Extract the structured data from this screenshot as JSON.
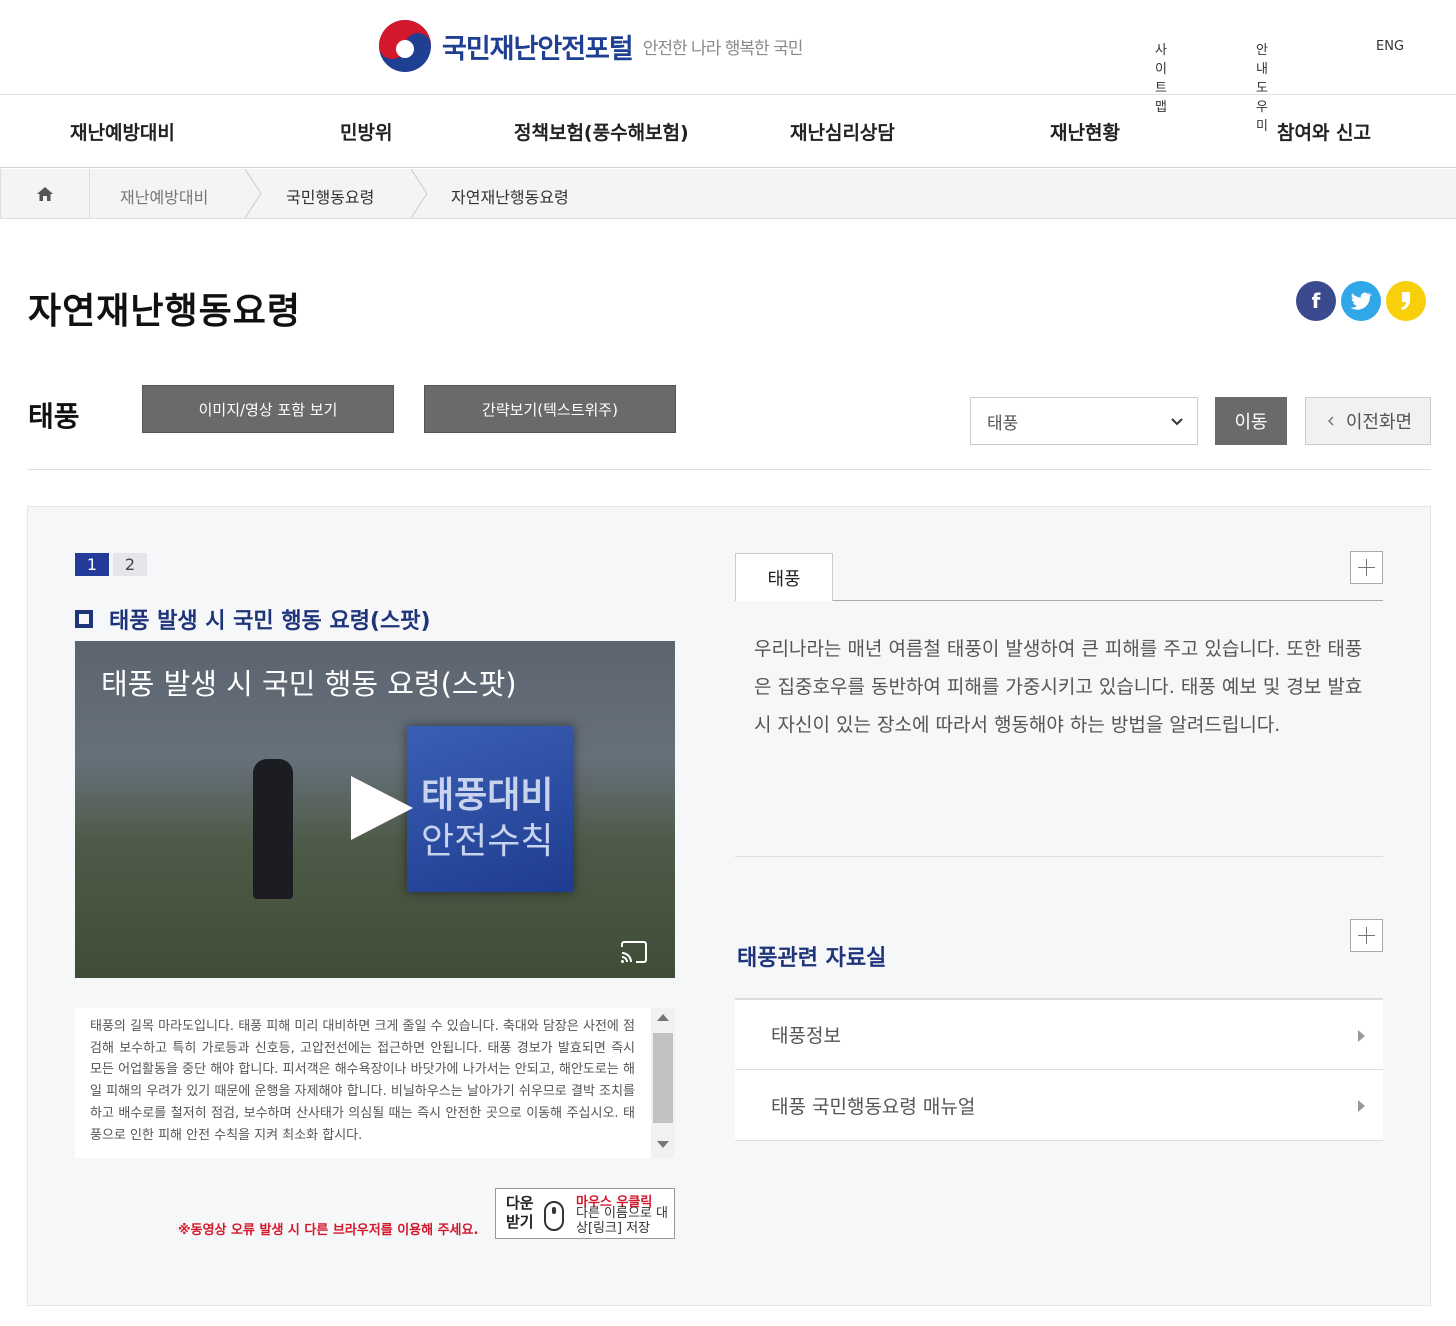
{
  "header": {
    "site_title": "국민재난안전포털",
    "slogan": "안전한 나라 행복한 국민",
    "util_links": [
      "사이트맵",
      "안내도우미",
      "ENG"
    ]
  },
  "gnb": [
    "재난예방대비",
    "민방위",
    "정책보험(풍수해보험)",
    "재난심리상담",
    "재난현황",
    "참여와 신고"
  ],
  "breadcrumb": [
    "재난예방대비",
    "국민행동요령",
    "자연재난행동요령"
  ],
  "page": {
    "title": "자연재난행동요령",
    "share": [
      "f",
      "t",
      "k"
    ]
  },
  "controls": {
    "section": "태풍",
    "view_full": "이미지/영상 포함 보기",
    "view_simple": "간략보기(텍스트위주)",
    "select_value": "태풍",
    "go": "이동",
    "back": "이전화면"
  },
  "video": {
    "pages": [
      "1",
      "2"
    ],
    "heading": "태풍 발생 시 국민 행동 요령(스팟)",
    "caption": "태풍 발생 시 국민 행동 요령(스팟)",
    "thumb_line1": "태풍대비",
    "thumb_line2": "안전수칙",
    "transcript": "태풍의 길목 마라도입니다. 태풍 피해 미리 대비하면 크게 줄일 수 있습니다. 축대와 담장은 사전에 점검해 보수하고 특히 가로등과 신호등, 고압전선에는 접근하면 안됩니다. 태풍 경보가 발효되면 즉시 모든 어업활동을 중단 해야 합니다. 피서객은 해수욕장이나 바닷가에 나가서는 안되고, 해안도로는 해일 피해의 우려가 있기 때문에 운행을 자제해야 합니다. 비닐하우스는 날아가기 쉬우므로 결박 조치를 하고 배수로를 철저히 점검, 보수하며 산사태가 의심될 때는 즉시 안전한 곳으로 이동해 주십시오. 태풍으로 인한 피해 안전 수칙을 지켜 최소화 합시다.",
    "notice": "※동영상 오류 발생 시 다른 브라우저를 이용해 주세요.",
    "download_label": "다운받기",
    "download_red": "마우스 우클릭",
    "download_text": "다른 이름으로 대상[링크] 저장"
  },
  "info": {
    "tab": "태풍",
    "text": "우리나라는 매년 여름철 태풍이 발생하여 큰 피해를 주고 있습니다. 또한 태풍은 집중호우를 동반하여 피해를 가중시키고 있습니다. 태풍 예보 및 경보 발효 시 자신이 있는 장소에 따라서 행동해야 하는 방법을 알려드립니다."
  },
  "related": {
    "title": "태풍관련 자료실",
    "items": [
      "태풍정보",
      "태풍 국민행동요령 매뉴얼"
    ]
  },
  "colors": {
    "brand_blue": "#1f3f93",
    "active_page": "#233c9b",
    "notice_red": "#d3182c",
    "facebook": "#3b4a8f",
    "twitter": "#2fa7e8",
    "kakao": "#f7cf0a"
  }
}
